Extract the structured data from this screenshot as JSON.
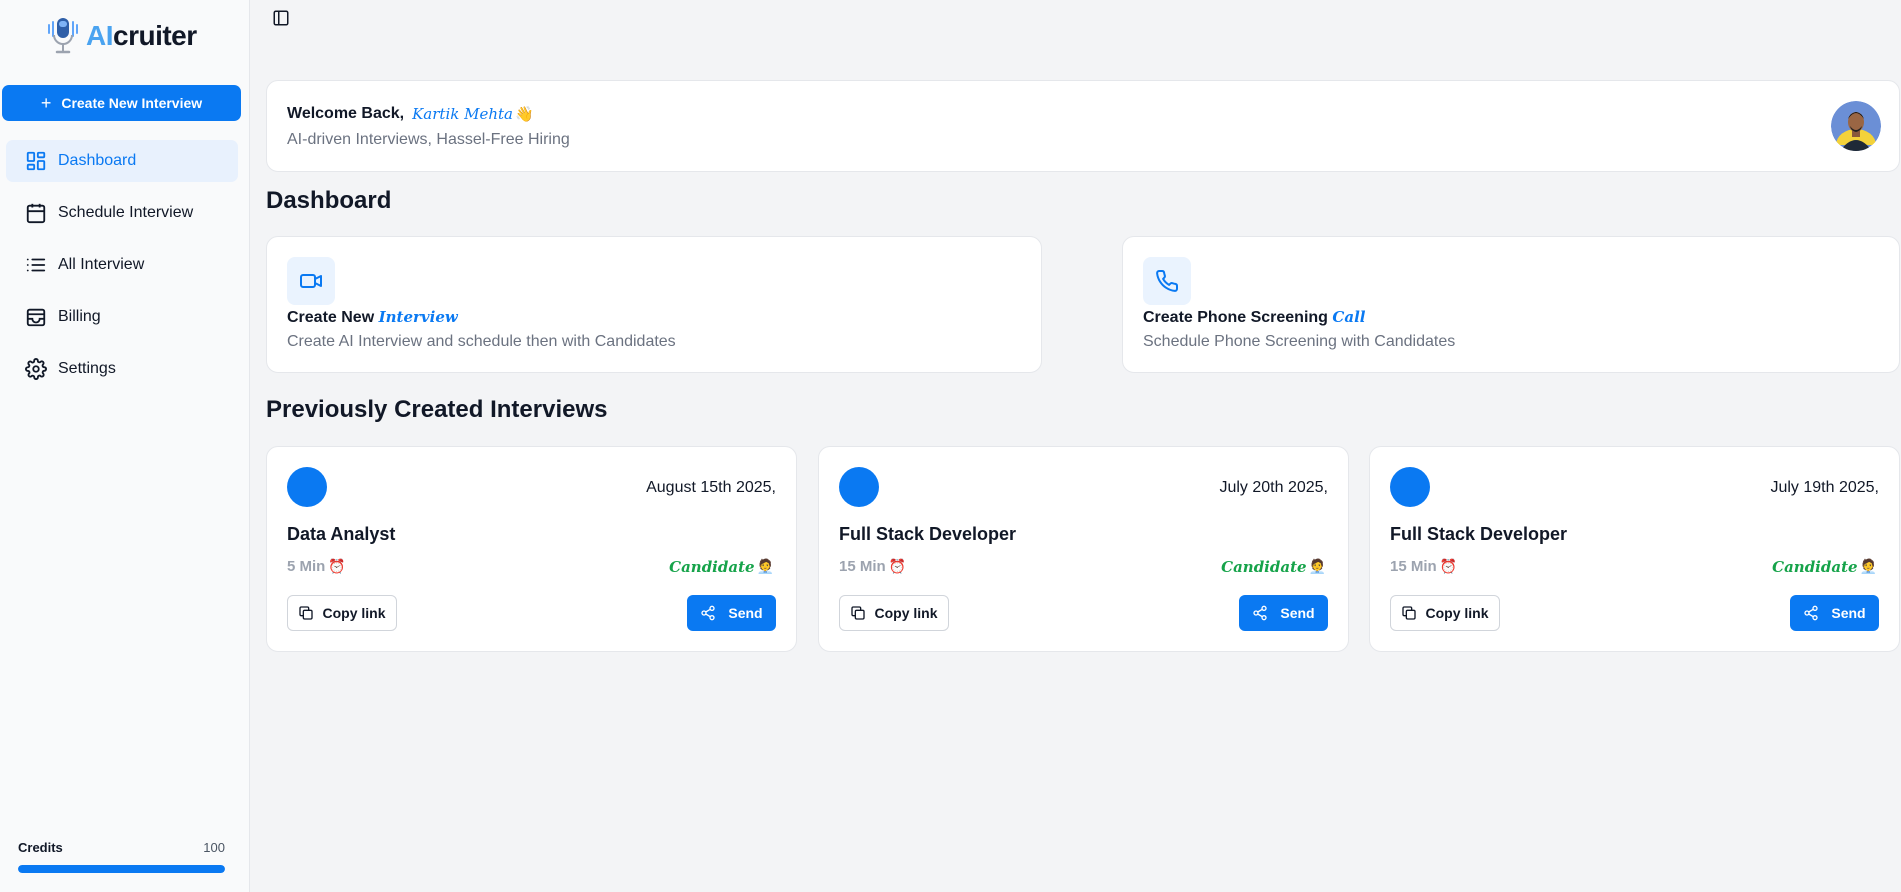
{
  "app": {
    "logo_ai": "AI",
    "logo_rest": "cruiter"
  },
  "sidebar": {
    "create_label": "Create New Interview",
    "items": [
      {
        "label": "Dashboard",
        "icon": "dashboard-icon",
        "active": true
      },
      {
        "label": "Schedule Interview",
        "icon": "calendar-icon"
      },
      {
        "label": "All Interview",
        "icon": "list-icon"
      },
      {
        "label": "Billing",
        "icon": "wallet-icon"
      },
      {
        "label": "Settings",
        "icon": "gear-icon"
      }
    ],
    "credits": {
      "label": "Credits",
      "value": "100",
      "progress": 1.0
    }
  },
  "welcome": {
    "greeting": "Welcome Back,",
    "name": "Kartik Mehta",
    "emoji": "👋",
    "subtitle": "AI-driven Interviews, Hassel-Free Hiring"
  },
  "dashboard": {
    "title": "Dashboard",
    "actions": [
      {
        "title": "Create New",
        "highlight": "Interview",
        "desc": "Create AI Interview and schedule then with Candidates",
        "icon": "video-icon"
      },
      {
        "title": "Create Phone Screening",
        "highlight": "Call",
        "desc": "Schedule Phone Screening with Candidates",
        "icon": "phone-icon"
      }
    ]
  },
  "previous": {
    "title": "Previously Created Interviews",
    "copy_label": "Copy link",
    "send_label": "Send",
    "candidate_label": "Candidate",
    "interviews": [
      {
        "date": "August 15th 2025,",
        "role": "Data Analyst",
        "duration": "5 Min"
      },
      {
        "date": "July 20th 2025,",
        "role": "Full Stack Developer",
        "duration": "15 Min"
      },
      {
        "date": "July 19th 2025,",
        "role": "Full Stack Developer",
        "duration": "15 Min"
      }
    ]
  },
  "colors": {
    "accent": "#0a79f2",
    "candidate": "#16a34a",
    "muted": "#6b7280"
  }
}
